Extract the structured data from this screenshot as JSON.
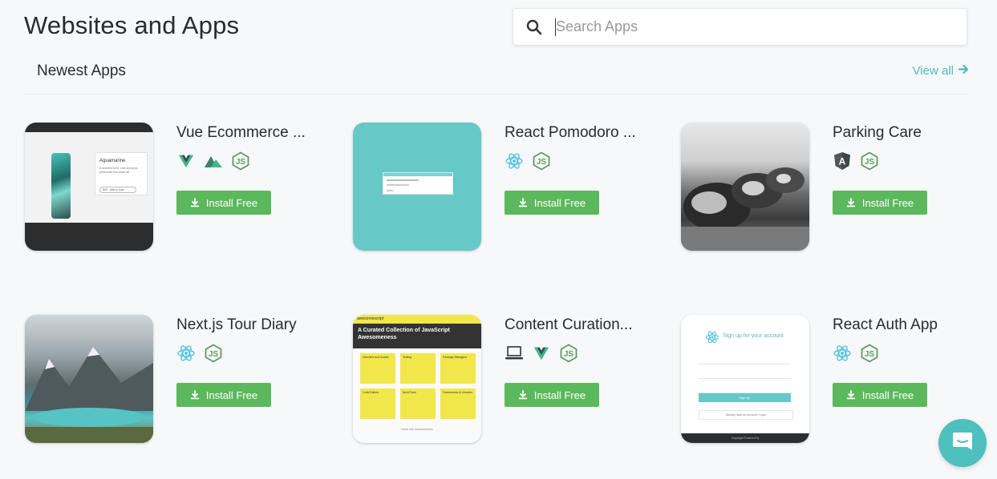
{
  "header": {
    "title": "Websites and Apps"
  },
  "search": {
    "placeholder": "Search Apps",
    "icon": "search-icon"
  },
  "section": {
    "title": "Newest Apps",
    "view_all": "View all"
  },
  "colors": {
    "accent": "#4cbcb8",
    "install": "#5cb85c",
    "teal_thumb": "#66c9c8",
    "chat": "#4ec0bd"
  },
  "apps": [
    {
      "name": "Vue Ecommerce ...",
      "techs": [
        "vue-icon",
        "nuxt-icon",
        "javascript-icon"
      ],
      "install_label": "Install Free",
      "thumb": {
        "product_title": "Aquamarine",
        "product_desc": "A beautiful shirt, bold and grea, perfect fits this dress all.",
        "price": "$43",
        "add_to_cart": "Add to Cart"
      }
    },
    {
      "name": "React Pomodoro ...",
      "techs": [
        "react-icon",
        "javascript-icon"
      ],
      "install_label": "Install Free"
    },
    {
      "name": "Parking Care",
      "techs": [
        "angular-icon",
        "javascript-icon"
      ],
      "install_label": "Install Free"
    },
    {
      "name": "Next.js Tour Diary",
      "techs": [
        "react-icon",
        "javascript-icon"
      ],
      "install_label": "Install Free"
    },
    {
      "name": "Content Curation...",
      "techs": [
        "laptop-icon",
        "vue-icon",
        "javascript-icon"
      ],
      "install_label": "Install Free",
      "thumb": {
        "banner": "awesomescript",
        "headline": "A Curated Collection of JavaScript Awesomeness",
        "tiles": [
          "Interview and Guides",
          "Testing",
          "Package Managers",
          "Code Editors",
          "Build Tools",
          "Frameworks & Libraries"
        ],
        "footer": "made with awesomeness"
      }
    },
    {
      "name": "React Auth App",
      "techs": [
        "react-icon",
        "javascript-icon"
      ],
      "install_label": "Install Free",
      "thumb": {
        "heading": "Sign up for your account",
        "submit": "Sign Up",
        "login_prompt": "Already have an account? Login",
        "footer": "Copyright Powered by"
      }
    }
  ]
}
